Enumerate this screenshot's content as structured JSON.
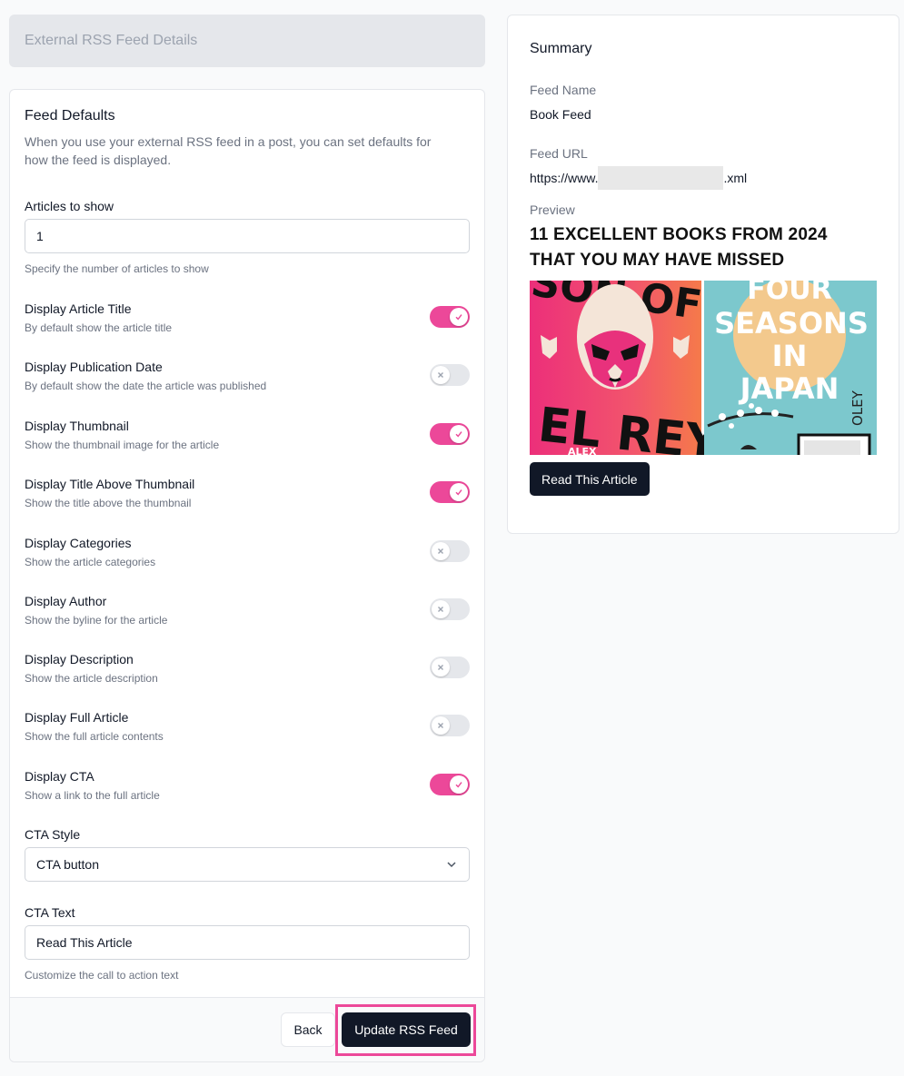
{
  "header": {
    "section_title": "External RSS Feed Details"
  },
  "defaults": {
    "title": "Feed Defaults",
    "description": "When you use your external RSS feed in a post, you can set defaults for how the feed is displayed.",
    "articles": {
      "label": "Articles to show",
      "value": "1",
      "help": "Specify the number of articles to show"
    },
    "toggles": [
      {
        "label": "Display Article Title",
        "help": "By default show the article title",
        "on": true
      },
      {
        "label": "Display Publication Date",
        "help": "By default show the date the article was published",
        "on": false
      },
      {
        "label": "Display Thumbnail",
        "help": "Show the thumbnail image for the article",
        "on": true
      },
      {
        "label": "Display Title Above Thumbnail",
        "help": "Show the title above the thumbnail",
        "on": true
      },
      {
        "label": "Display Categories",
        "help": "Show the article categories",
        "on": false
      },
      {
        "label": "Display Author",
        "help": "Show the byline for the article",
        "on": false
      },
      {
        "label": "Display Description",
        "help": "Show the article description",
        "on": false
      },
      {
        "label": "Display Full Article",
        "help": "Show the full article contents",
        "on": false
      },
      {
        "label": "Display CTA",
        "help": "Show a link to the full article",
        "on": true
      }
    ],
    "cta_style": {
      "label": "CTA Style",
      "value": "CTA button"
    },
    "cta_text": {
      "label": "CTA Text",
      "value": "Read This Article",
      "help": "Customize the call to action text"
    }
  },
  "footer": {
    "back_label": "Back",
    "update_label": "Update RSS Feed"
  },
  "summary": {
    "title": "Summary",
    "feed_name_label": "Feed Name",
    "feed_name": "Book Feed",
    "feed_url_label": "Feed URL",
    "feed_url_prefix": "https://www.",
    "feed_url_suffix": ".xml",
    "preview_label": "Preview",
    "preview_title": "11 EXCELLENT BOOKS FROM 2024 THAT YOU MAY HAVE MISSED",
    "cover_left_text_top": "SON OF",
    "cover_left_text_bottom": "EL REY",
    "cover_left_author": "ALEX",
    "cover_right_text_1": "FOUR",
    "cover_right_text_2": "SEASONS",
    "cover_right_text_3": "IN",
    "cover_right_text_4": "JAPAN",
    "cover_right_author": "OLEY",
    "cta_label": "Read This Article"
  },
  "colors": {
    "accent_pink": "#ec4899",
    "dark_button": "#111827",
    "toggle_off": "#e5e7eb"
  }
}
